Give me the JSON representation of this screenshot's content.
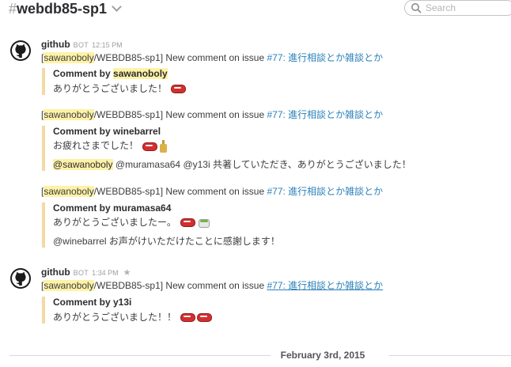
{
  "channel": {
    "hash": "#",
    "name": "webdb85-sp1"
  },
  "search": {
    "placeholder": "Search"
  },
  "messages": [
    {
      "user": "github",
      "badge": "BOT",
      "time": "12:15 PM",
      "events": [
        {
          "bracket_open": "[",
          "repo_owner": "sawanoboly",
          "repo_rest": "/WEBDB85-sp1] New comment on issue ",
          "issue_link": "#77: 進行相談とか雑談とか",
          "title_prefix": "Comment by ",
          "title_user": "sawanoboly",
          "body": "ありがとうございました！"
        },
        {
          "bracket_open": "[",
          "repo_owner": "sawanoboly",
          "repo_rest": "/WEBDB85-sp1] New comment on issue ",
          "issue_link": "#77: 進行相談とか雑談とか",
          "title": "Comment by winebarrel",
          "body": "お疲れさまでした！",
          "body2_mention": "@sawanoboly",
          "body2_rest": " @muramasa64 @y13i 共著していただき、ありがとうございました！"
        },
        {
          "bracket_open": "[",
          "repo_owner": "sawanoboly",
          "repo_rest": "/WEBDB85-sp1] New comment on issue ",
          "issue_link": "#77: 進行相談とか雑談とか",
          "title": "Comment by muramasa64",
          "body": "ありがとうございましたー。",
          "body2": "@winebarrel お声がけいただけたことに感謝します！"
        }
      ]
    },
    {
      "user": "github",
      "badge": "BOT",
      "time": "1:34 PM",
      "star": "★",
      "events": [
        {
          "bracket_open": "[",
          "repo_owner": "sawanoboly",
          "repo_rest": "/WEBDB85-sp1] New comment on issue ",
          "issue_link": "#77: 進行相談とか雑談とか",
          "title": "Comment by y13i",
          "body": "ありがとうございました！！"
        }
      ]
    }
  ],
  "date_divider": "February 3rd, 2015",
  "icons": {
    "avatar": "github-octocat-icon",
    "search": "search-icon",
    "chevron": "chevron-down-icon",
    "star": "star-icon",
    "sushi": "sushi-emoji",
    "sake": "sake-emoji",
    "tea": "tea-emoji"
  },
  "colors": {
    "link": "#2a80b9",
    "highlight": "#fdf2a6",
    "attachment_bar": "#f5d9a4"
  }
}
